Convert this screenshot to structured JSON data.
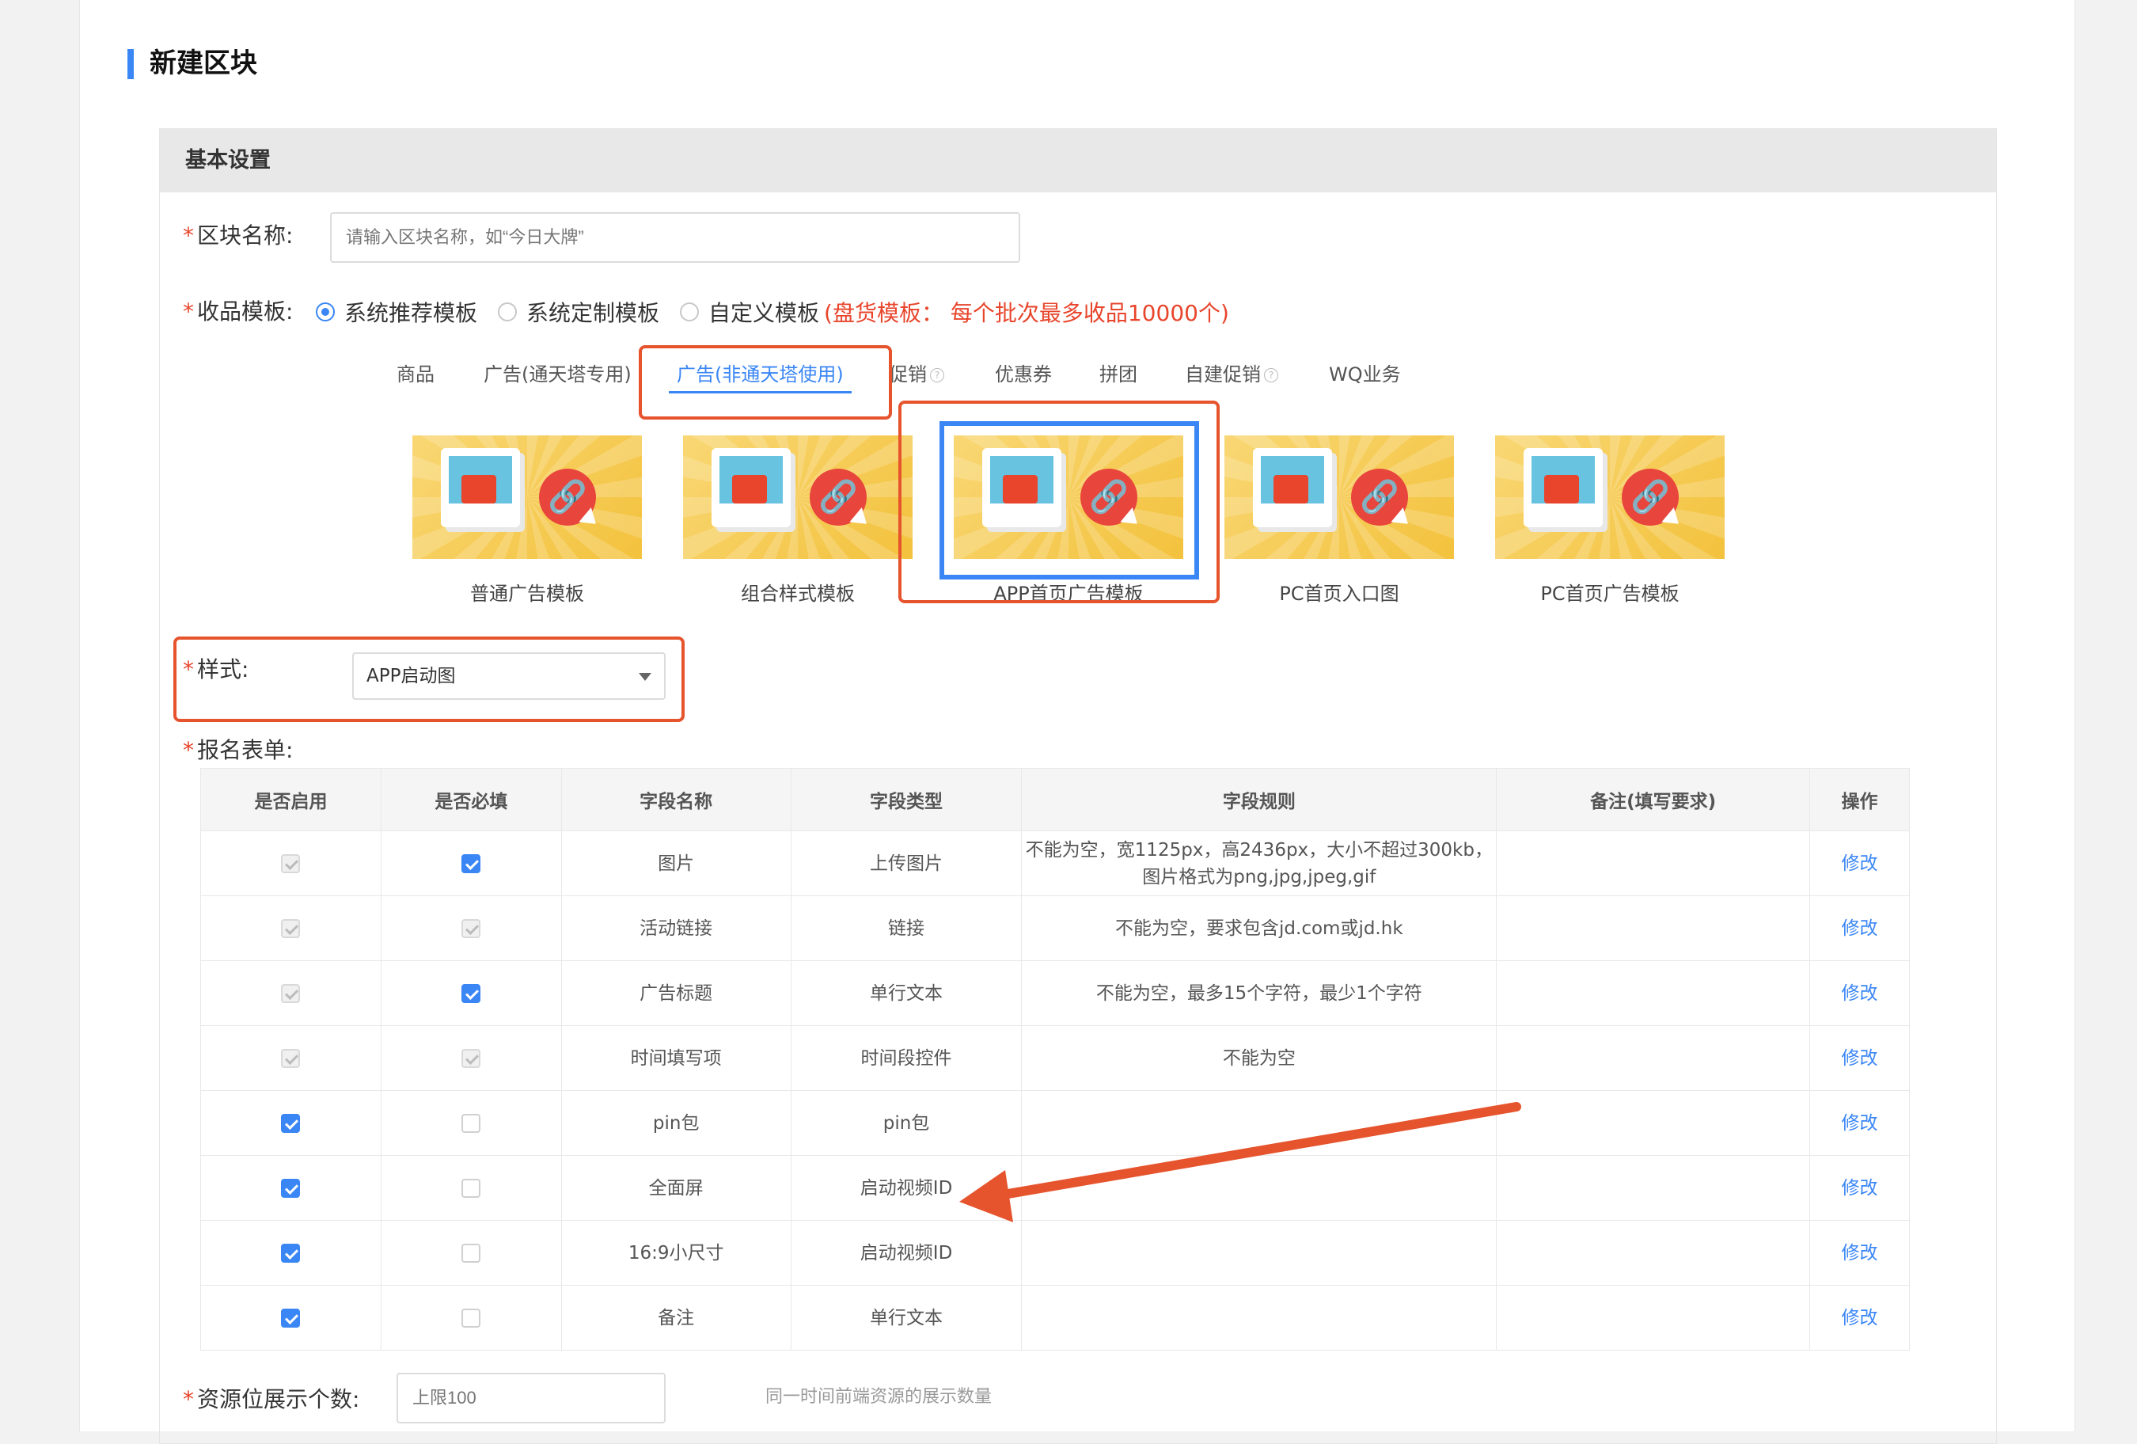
{
  "page": {
    "title": "新建区块",
    "section": "基本设置"
  },
  "form": {
    "block_name": {
      "label": "区块名称:",
      "placeholder": "请输入区块名称，如“今日大牌”"
    },
    "template": {
      "label": "收品模板:",
      "options": [
        "系统推荐模板",
        "系统定制模板",
        "自定义模板"
      ],
      "selected": "系统推荐模板",
      "note": "(盘货模板： 每个批次最多收品10000个)"
    },
    "tabs": [
      "商品",
      "广告(通天塔专用)",
      "广告(非通天塔使用)",
      "促销",
      "优惠券",
      "拼团",
      "自建促销",
      "WQ业务"
    ],
    "active_tab": "广告(非通天塔使用)",
    "templates": [
      "普通广告模板",
      "组合样式模板",
      "APP首页广告模板",
      "PC首页入口图",
      "PC首页广告模板"
    ],
    "selected_template": "APP首页广告模板",
    "style": {
      "label": "样式:",
      "value": "APP启动图"
    },
    "signup_form": {
      "label": "报名表单:"
    },
    "resource_count": {
      "label": "资源位展示个数:",
      "placeholder": "上限100",
      "hint": "同一时间前端资源的展示数量"
    }
  },
  "table": {
    "headers": [
      "是否启用",
      "是否必填",
      "字段名称",
      "字段类型",
      "字段规则",
      "备注(填写要求)",
      "操作"
    ],
    "rows": [
      {
        "enabled": "disabled-checked",
        "required": "checked",
        "name": "图片",
        "type": "上传图片",
        "rule_line1": "不能为空，宽1125px，高2436px，大小不超过300kb，",
        "rule_line2": "图片格式为png,jpg,jpeg,gif",
        "note": "",
        "action": "修改"
      },
      {
        "enabled": "disabled-checked",
        "required": "disabled-checked",
        "name": "活动链接",
        "type": "链接",
        "rule_line1": "不能为空，要求包含jd.com或jd.hk",
        "rule_line2": "",
        "note": "",
        "action": "修改"
      },
      {
        "enabled": "disabled-checked",
        "required": "checked",
        "name": "广告标题",
        "type": "单行文本",
        "rule_line1": "不能为空，最多15个字符，最少1个字符",
        "rule_line2": "",
        "note": "",
        "action": "修改"
      },
      {
        "enabled": "disabled-checked",
        "required": "disabled-checked",
        "name": "时间填写项",
        "type": "时间段控件",
        "rule_line1": "不能为空",
        "rule_line2": "",
        "note": "",
        "action": "修改"
      },
      {
        "enabled": "checked",
        "required": "unchecked",
        "name": "pin包",
        "type": "pin包",
        "rule_line1": "",
        "rule_line2": "",
        "note": "",
        "action": "修改"
      },
      {
        "enabled": "checked",
        "required": "unchecked",
        "name": "全面屏",
        "type": "启动视频ID",
        "rule_line1": "",
        "rule_line2": "",
        "note": "",
        "action": "修改"
      },
      {
        "enabled": "checked",
        "required": "unchecked",
        "name": "16:9小尺寸",
        "type": "启动视频ID",
        "rule_line1": "",
        "rule_line2": "",
        "note": "",
        "action": "修改"
      },
      {
        "enabled": "checked",
        "required": "unchecked",
        "name": "备注",
        "type": "单行文本",
        "rule_line1": "",
        "rule_line2": "",
        "note": "",
        "action": "修改"
      }
    ]
  },
  "colors": {
    "accent": "#3a86f5",
    "annotation_red": "#e6542e",
    "required_star": "#e8452c"
  },
  "icons": {
    "link_badge": "link-icon",
    "help": "question-circle-icon",
    "dropdown": "caret-down-icon"
  }
}
